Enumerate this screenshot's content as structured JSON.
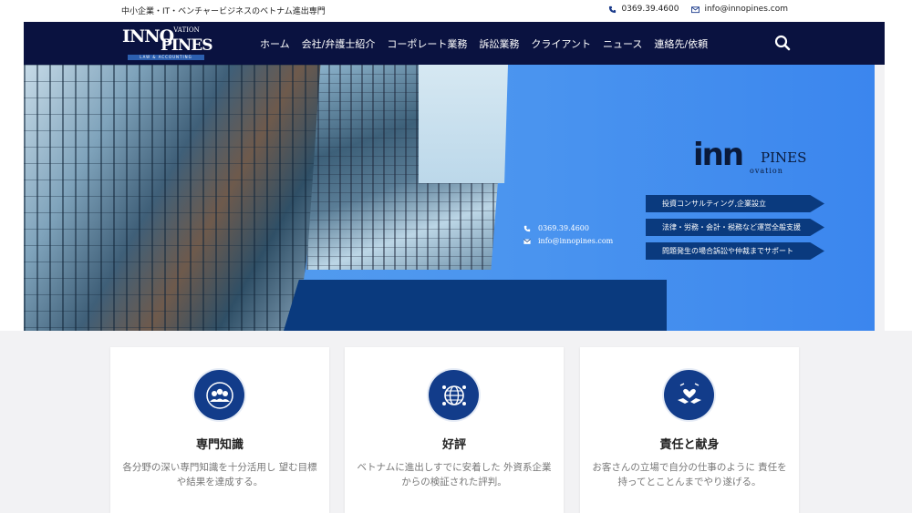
{
  "topbar": {
    "tagline": "中小企業・IT・ベンチャービジネスのベトナム進出専門",
    "phone": "0369.39.4600",
    "email": "info@innopines.com"
  },
  "logo": {
    "line1": "INNO",
    "line1_small": "VATION",
    "line2": "PINES",
    "tagline": "LAW & ACCOUNTING"
  },
  "nav": {
    "items": [
      {
        "label": "ホーム"
      },
      {
        "label": "会社/弁護士紹介"
      },
      {
        "label": "コーポレート業務"
      },
      {
        "label": "訴訟業務"
      },
      {
        "label": "クライアント"
      },
      {
        "label": "ニュース"
      },
      {
        "label": "連絡先/依頼"
      }
    ],
    "search_icon": "search-icon"
  },
  "hero": {
    "brand_inn": "inn",
    "brand_pines": "PINES",
    "brand_ovation": "ovation",
    "phone": "0369.39.4600",
    "email": "info@innopines.com",
    "services": [
      "投資コンサルティング,企業設立",
      "法律・労務・会計・税務など運営全般支援",
      "問題発生の場合訴訟や仲裁までサポート"
    ]
  },
  "features": [
    {
      "icon": "expert-team-icon",
      "title": "専門知識",
      "text": "各分野の深い専門知識を十分活用し 望む目標や結果を達成する。"
    },
    {
      "icon": "global-network-icon",
      "title": "好評",
      "text": "ベトナムに進出しすでに安着した 外資系企業からの検証された評判。"
    },
    {
      "icon": "handshake-heart-icon",
      "title": "責任と献身",
      "text": "お客さんの立場で自分の仕事のように 責任を持ってとことんまでやり遂げる。"
    }
  ],
  "colors": {
    "navy": "#0a1240",
    "accent": "#123c8a",
    "hero_blue": "#4a94ef"
  }
}
